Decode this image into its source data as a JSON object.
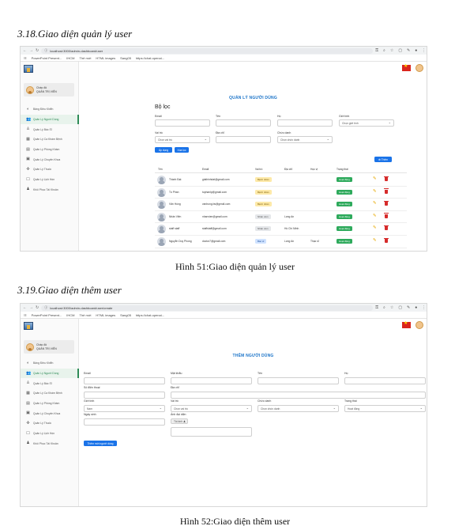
{
  "section1": {
    "heading": "3.18.Giao diện quản lý user",
    "caption": "Hình 51:Giao diện quản lý user"
  },
  "section2": {
    "heading": "3.19.Giao diện thêm user",
    "caption": "Hình 52:Giao diện thêm user"
  },
  "browser1": {
    "url": "localhost:3000/admin-dashboard/user",
    "bookmarks": [
      "PowerPoint Present...",
      "IHCM",
      "Thẻ mới",
      "HTML images",
      "Sang05",
      "https://chat.openai..."
    ]
  },
  "browser2": {
    "url": "localhost:3000/admin-dashboard/user/create",
    "bookmarks": [
      "PowerPoint Present...",
      "IHCM",
      "Thẻ mới",
      "HTML images",
      "Sang05",
      "https://chat.openai..."
    ]
  },
  "user": {
    "greeting": "Chào đò",
    "role": "QUẢN TRỊ VIÊN"
  },
  "menu": [
    {
      "label": "Bảng Điều Khiển",
      "icon": "dashboard-icon"
    },
    {
      "label": "Quản Lý Người Dùng",
      "icon": "users-icon"
    },
    {
      "label": "Quản Lý Bác Sĩ",
      "icon": "doctor-icon"
    },
    {
      "label": "Quản Lý Ca Khám Bệnh",
      "icon": "calendar-icon"
    },
    {
      "label": "Quản Lý Phòng Khám",
      "icon": "clinic-icon"
    },
    {
      "label": "Quản Lý Chuyên Khoa",
      "icon": "specialty-icon"
    },
    {
      "label": "Quản Lý Thuốc",
      "icon": "medicine-icon"
    },
    {
      "label": "Quản Lý Lịch Hẹn",
      "icon": "appointment-icon"
    },
    {
      "label": "Khôi Phục Tài Khoản",
      "icon": "restore-icon"
    }
  ],
  "manage": {
    "title": "QUẢN LÝ NGƯỜI DÙNG",
    "filter_title": "Bộ lọc",
    "labels": {
      "email": "Email",
      "name": "Tên",
      "lastname": "Họ",
      "gender": "Giới tính",
      "role": "Vai trò",
      "address": "Địa chỉ",
      "position": "Chức danh"
    },
    "gender_value": "Chọn giới tính",
    "role_value": "Chọn vai trò",
    "position_value": "Chọn chức danh",
    "apply_button": "Áp dụng",
    "clear_button": "Xóa lọc",
    "add_button": "Thêm",
    "columns": [
      "Tên",
      "Email",
      "Vai trò",
      "Địa chỉ",
      "Học vị",
      "Trạng thái"
    ],
    "rows": [
      {
        "name": "Thành Đạt",
        "email": "giathinhdat@gmail.com",
        "role": "Bệnh nhân",
        "role_type": "admin",
        "address": "",
        "degree": "",
        "status": "Hoạt động"
      },
      {
        "name": "Tú Phan",
        "email": "tuphanlp@gmail.com",
        "role": "Bệnh nhân",
        "role_type": "admin",
        "address": "",
        "degree": "",
        "status": "Hoạt động"
      },
      {
        "name": "Văn Hùng",
        "email": "vanhung.bs@gmail.com",
        "role": "Bệnh nhân",
        "role_type": "admin",
        "address": "",
        "degree": "",
        "status": "Hoạt động"
      },
      {
        "name": "Nhân Viên",
        "email": "nhanvien@gmail.com",
        "role": "Nhân viên",
        "role_type": "staff",
        "address": "Long An",
        "degree": "",
        "status": "Hoạt động"
      },
      {
        "name": "staff staff",
        "email": "staffstaff@gmail.com",
        "role": "Nhân viên",
        "role_type": "staff",
        "address": "Hồ Chí Minh",
        "degree": "",
        "status": "Hoạt động"
      },
      {
        "name": "Nguyễn Duy Phong",
        "email": "doctor7@gmail.com",
        "role": "Bác sĩ",
        "role_type": "doctor",
        "address": "Long An",
        "degree": "Thạc sĩ",
        "status": "Hoạt động"
      }
    ]
  },
  "create": {
    "title": "THÊM NGƯỜI DÙNG",
    "labels": {
      "email": "Email",
      "password": "Mật khẩu",
      "name": "Tên",
      "lastname": "Họ",
      "phone": "Số điện thoại",
      "address": "Địa chỉ",
      "gender": "Giới tính",
      "role": "Vai trò",
      "position": "Chức danh",
      "status": "Trạng thái",
      "birthday": "Ngày sinh",
      "avatar": "Ảnh đại diện"
    },
    "gender_value": "Nam",
    "role_value": "Chọn vai trò",
    "position_value": "Chọn chức danh",
    "status_value": "Hoạt động",
    "upload_button": "Tải ảnh",
    "submit_button": "Thêm mới người dùng"
  }
}
